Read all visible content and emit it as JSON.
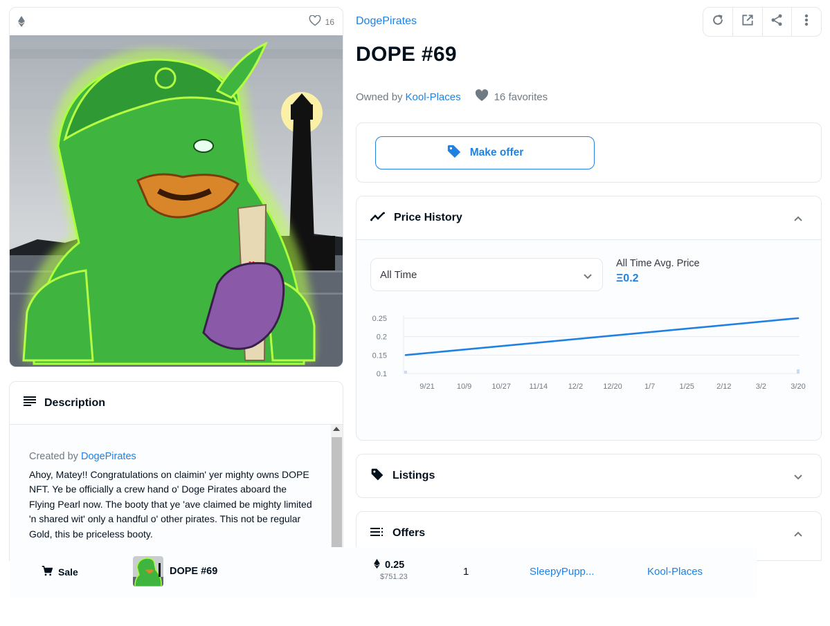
{
  "colors": {
    "accent": "#2081e2",
    "text": "#04111d",
    "muted": "#707a83",
    "border": "#e5e8eb"
  },
  "media": {
    "favorites": "16"
  },
  "item": {
    "collection": "DogePirates",
    "title": "DOPE #69",
    "owned_by_label": "Owned by",
    "owner": "Kool-Places",
    "favorites_label": "16 favorites"
  },
  "toolbar": {
    "icons": [
      "refresh-icon",
      "external-link-icon",
      "share-icon",
      "more-vert-icon"
    ]
  },
  "offer": {
    "make_offer_label": "Make offer"
  },
  "price_history": {
    "title": "Price History",
    "range_selected": "All Time",
    "avg_label": "All Time Avg. Price",
    "avg_value": "Ξ0.2"
  },
  "chart_data": {
    "type": "line",
    "title": "",
    "xlabel": "",
    "ylabel": "",
    "x_ticks": [
      "9/21",
      "10/9",
      "10/27",
      "11/14",
      "12/2",
      "12/20",
      "1/7",
      "1/25",
      "2/12",
      "3/2",
      "3/20"
    ],
    "y_ticks": [
      "0.25",
      "0.2",
      "0.15",
      "0.1"
    ],
    "ylim": [
      0.1,
      0.25
    ],
    "series": [
      {
        "points": [
          {
            "x": "9/3",
            "y": 0.15
          },
          {
            "x": "3/20",
            "y": 0.25
          }
        ]
      }
    ],
    "grid": true
  },
  "description": {
    "title": "Description",
    "created_by_label": "Created by",
    "creator": "DogePirates",
    "text": "Ahoy, Matey!! Congratulations on claimin' yer mighty owns DOPE NFT. Ye be officially a crew hand o' Doge Pirates aboard the Flying Pearl now. The booty that ye 'ave claimed be mighty limited 'n shared wit' only a handful o' other pirates. This not be regular Gold, this be priceless booty."
  },
  "listings": {
    "title": "Listings"
  },
  "offers": {
    "title": "Offers"
  },
  "activity": {
    "event": "Sale",
    "item_name": "DOPE #69",
    "price_eth": "0.25",
    "price_usd": "$751.23",
    "quantity": "1",
    "from": "SleepyPupp...",
    "to": "Kool-Places"
  }
}
